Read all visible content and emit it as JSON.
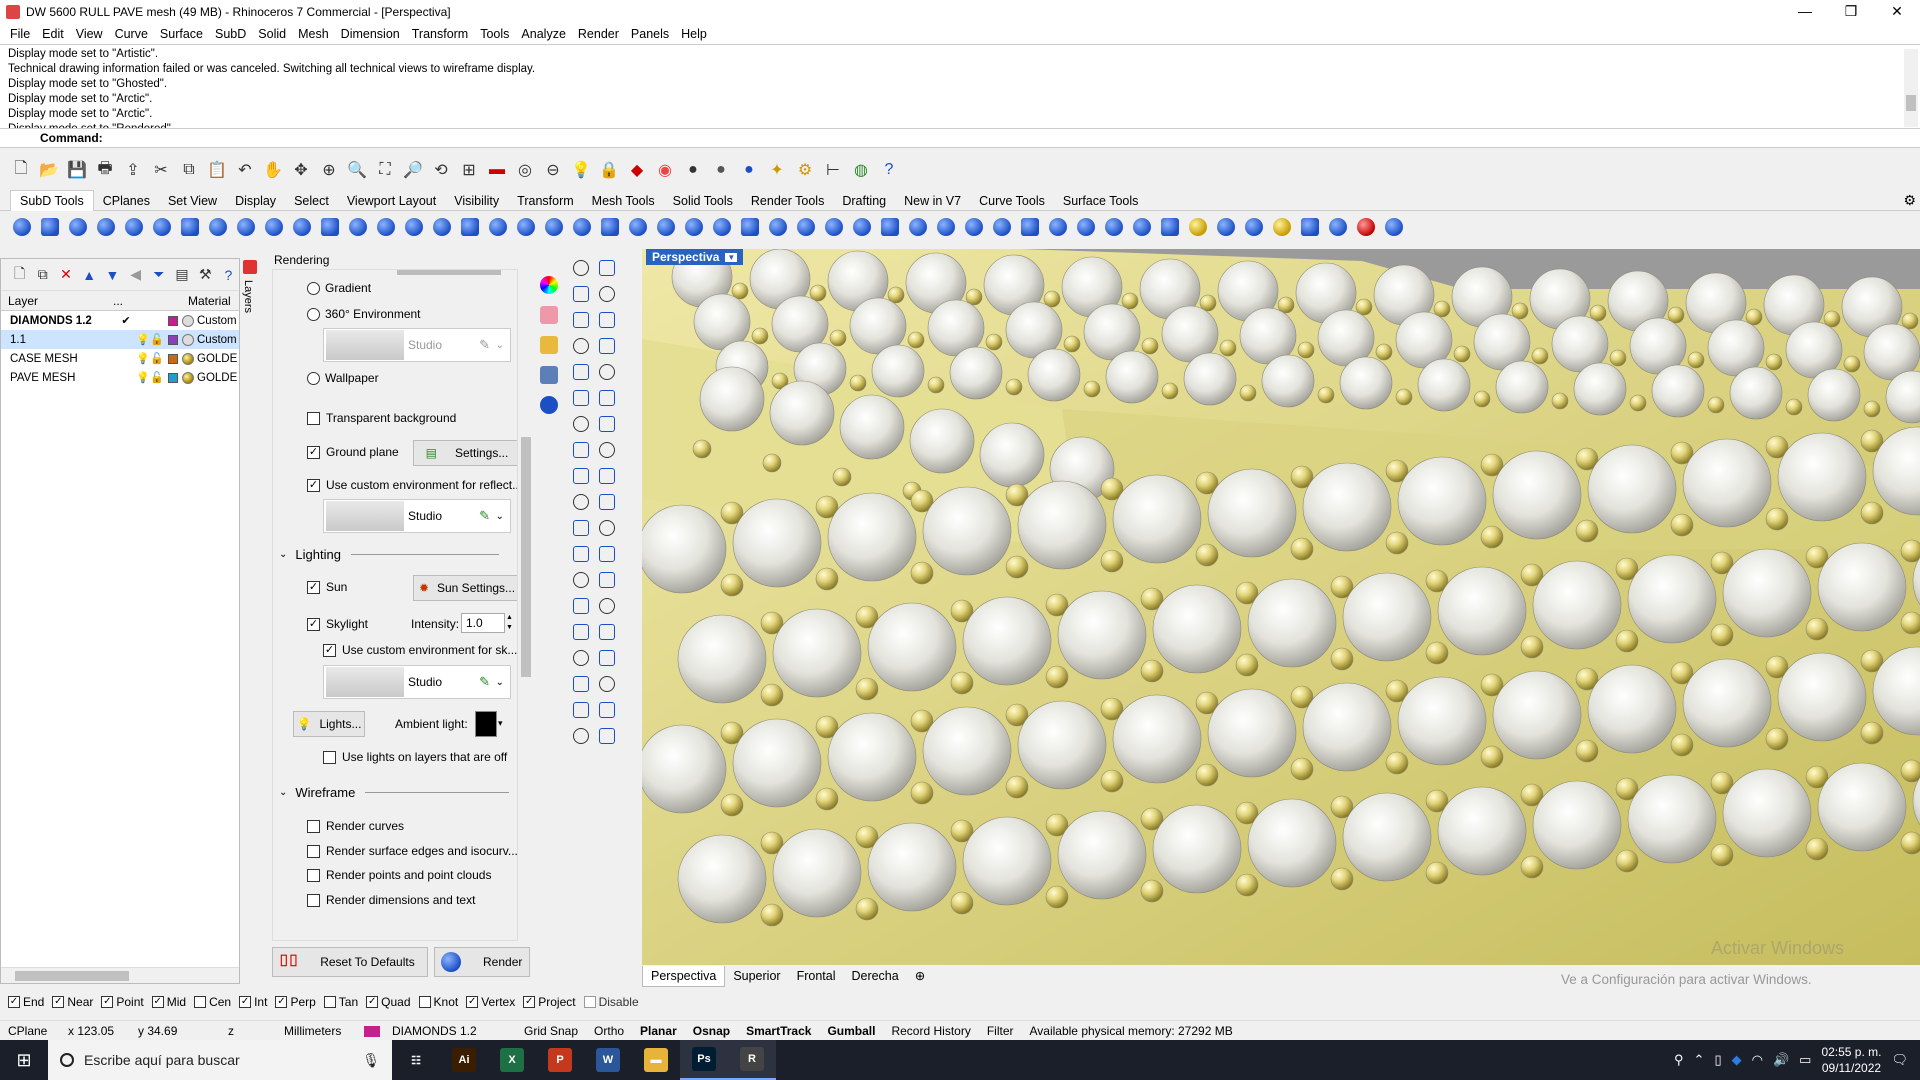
{
  "window": {
    "title": "DW 5600 RULL PAVE mesh (49 MB) - Rhinoceros 7 Commercial - [Perspectiva]",
    "controls": [
      "—",
      "❒",
      "✕"
    ]
  },
  "menu": [
    "File",
    "Edit",
    "View",
    "Curve",
    "Surface",
    "SubD",
    "Solid",
    "Mesh",
    "Dimension",
    "Transform",
    "Tools",
    "Analyze",
    "Render",
    "Panels",
    "Help"
  ],
  "history": [
    "Display mode set to \"Artistic\".",
    "Technical drawing information failed or was canceled. Switching all technical views to wireframe display.",
    "Display mode set to \"Ghosted\".",
    "Display mode set to \"Arctic\".",
    "Display mode set to \"Arctic\".",
    "Display mode set to \"Rendered\"."
  ],
  "command": {
    "label": "Command:"
  },
  "toolbar_tabs": [
    "SubD Tools",
    "CPlanes",
    "Set View",
    "Display",
    "Select",
    "Viewport Layout",
    "Visibility",
    "Transform",
    "Mesh Tools",
    "Solid Tools",
    "Render Tools",
    "Drafting",
    "New in V7",
    "Curve Tools",
    "Surface Tools"
  ],
  "layers": {
    "tab_label": "Layers",
    "columns": {
      "layer": "Layer",
      "current": "...",
      "material": "Material"
    },
    "rows": [
      {
        "name": "DIAMONDS 1.2",
        "check": "✔",
        "color": "#c71e8e",
        "material": "Custom",
        "bold": true,
        "selected": false
      },
      {
        "name": "1.1",
        "check": "",
        "color": "#8c3fb8",
        "material": "Custom",
        "bold": false,
        "selected": true
      },
      {
        "name": "CASE MESH",
        "check": "",
        "color": "#c86a14",
        "material": "GOLDEN",
        "bold": false,
        "selected": false
      },
      {
        "name": "PAVE MESH",
        "check": "",
        "color": "#1fa0c8",
        "material": "GOLDEN",
        "bold": false,
        "selected": false
      }
    ]
  },
  "rendering": {
    "header": "Rendering",
    "gradient": "Gradient",
    "env360": "360° Environment",
    "env_studio_disabled": "Studio",
    "wallpaper": "Wallpaper",
    "transparent_bg": "Transparent background",
    "ground_plane": "Ground plane",
    "ground_settings": "Settings...",
    "custom_env_reflect": "Use custom environment for reflect...",
    "studio_reflect": "Studio",
    "lighting_header": "Lighting",
    "sun": "Sun",
    "sun_settings": "Sun Settings...",
    "skylight": "Skylight",
    "intensity_label": "Intensity:",
    "intensity_value": "1.0",
    "custom_env_sky": "Use custom environment for sk...",
    "studio_sky": "Studio",
    "lights_btn": "Lights...",
    "ambient_label": "Ambient light:",
    "use_lights_layers": "Use lights on layers that are off",
    "wireframe_header": "Wireframe",
    "render_curves": "Render curves",
    "render_edges": "Render surface edges and isocurv...",
    "render_points": "Render points and point clouds",
    "render_dims": "Render dimensions and text",
    "reset_btn": "Reset To Defaults",
    "render_btn": "Render"
  },
  "viewport": {
    "title": "Perspectiva",
    "tabs": [
      "Perspectiva",
      "Superior",
      "Frontal",
      "Derecha"
    ],
    "add_tab": "⊕",
    "watermark_line1": "Activar Windows",
    "watermark_line2": "Ve a Configuración para activar Windows."
  },
  "osnap": [
    {
      "label": "End",
      "checked": true
    },
    {
      "label": "Near",
      "checked": true
    },
    {
      "label": "Point",
      "checked": true
    },
    {
      "label": "Mid",
      "checked": true
    },
    {
      "label": "Cen",
      "checked": false
    },
    {
      "label": "Int",
      "checked": true
    },
    {
      "label": "Perp",
      "checked": true
    },
    {
      "label": "Tan",
      "checked": false
    },
    {
      "label": "Quad",
      "checked": true
    },
    {
      "label": "Knot",
      "checked": false
    },
    {
      "label": "Vertex",
      "checked": true
    },
    {
      "label": "Project",
      "checked": true
    },
    {
      "label": "Disable",
      "checked": false
    }
  ],
  "status": {
    "cplane": "CPlane",
    "x": "x 123.05",
    "y": "y 34.69",
    "z": "z",
    "units": "Millimeters",
    "layer": "DIAMONDS 1.2",
    "toggles": [
      {
        "label": "Grid Snap",
        "bold": false
      },
      {
        "label": "Ortho",
        "bold": false
      },
      {
        "label": "Planar",
        "bold": true
      },
      {
        "label": "Osnap",
        "bold": true
      },
      {
        "label": "SmartTrack",
        "bold": true
      },
      {
        "label": "Gumball",
        "bold": true
      },
      {
        "label": "Record History",
        "bold": false
      },
      {
        "label": "Filter",
        "bold": false
      }
    ],
    "memory": "Available physical memory: 27292 MB"
  },
  "taskbar": {
    "search_placeholder": "Escribe aquí para buscar",
    "time": "02:55 p. m.",
    "date": "09/11/2022",
    "apps": [
      {
        "name": "task-view",
        "label": "☷",
        "color": "transparent"
      },
      {
        "name": "illustrator",
        "label": "Ai",
        "color": "#3b1d00"
      },
      {
        "name": "excel",
        "label": "X",
        "color": "#1d7044"
      },
      {
        "name": "powerpoint",
        "label": "P",
        "color": "#c4391d"
      },
      {
        "name": "word",
        "label": "W",
        "color": "#2b579a"
      },
      {
        "name": "file-explorer",
        "label": "▬",
        "color": "#e7b33b"
      },
      {
        "name": "photoshop",
        "label": "Ps",
        "color": "#001d34"
      },
      {
        "name": "rhino",
        "label": "R",
        "color": "#444"
      }
    ]
  }
}
